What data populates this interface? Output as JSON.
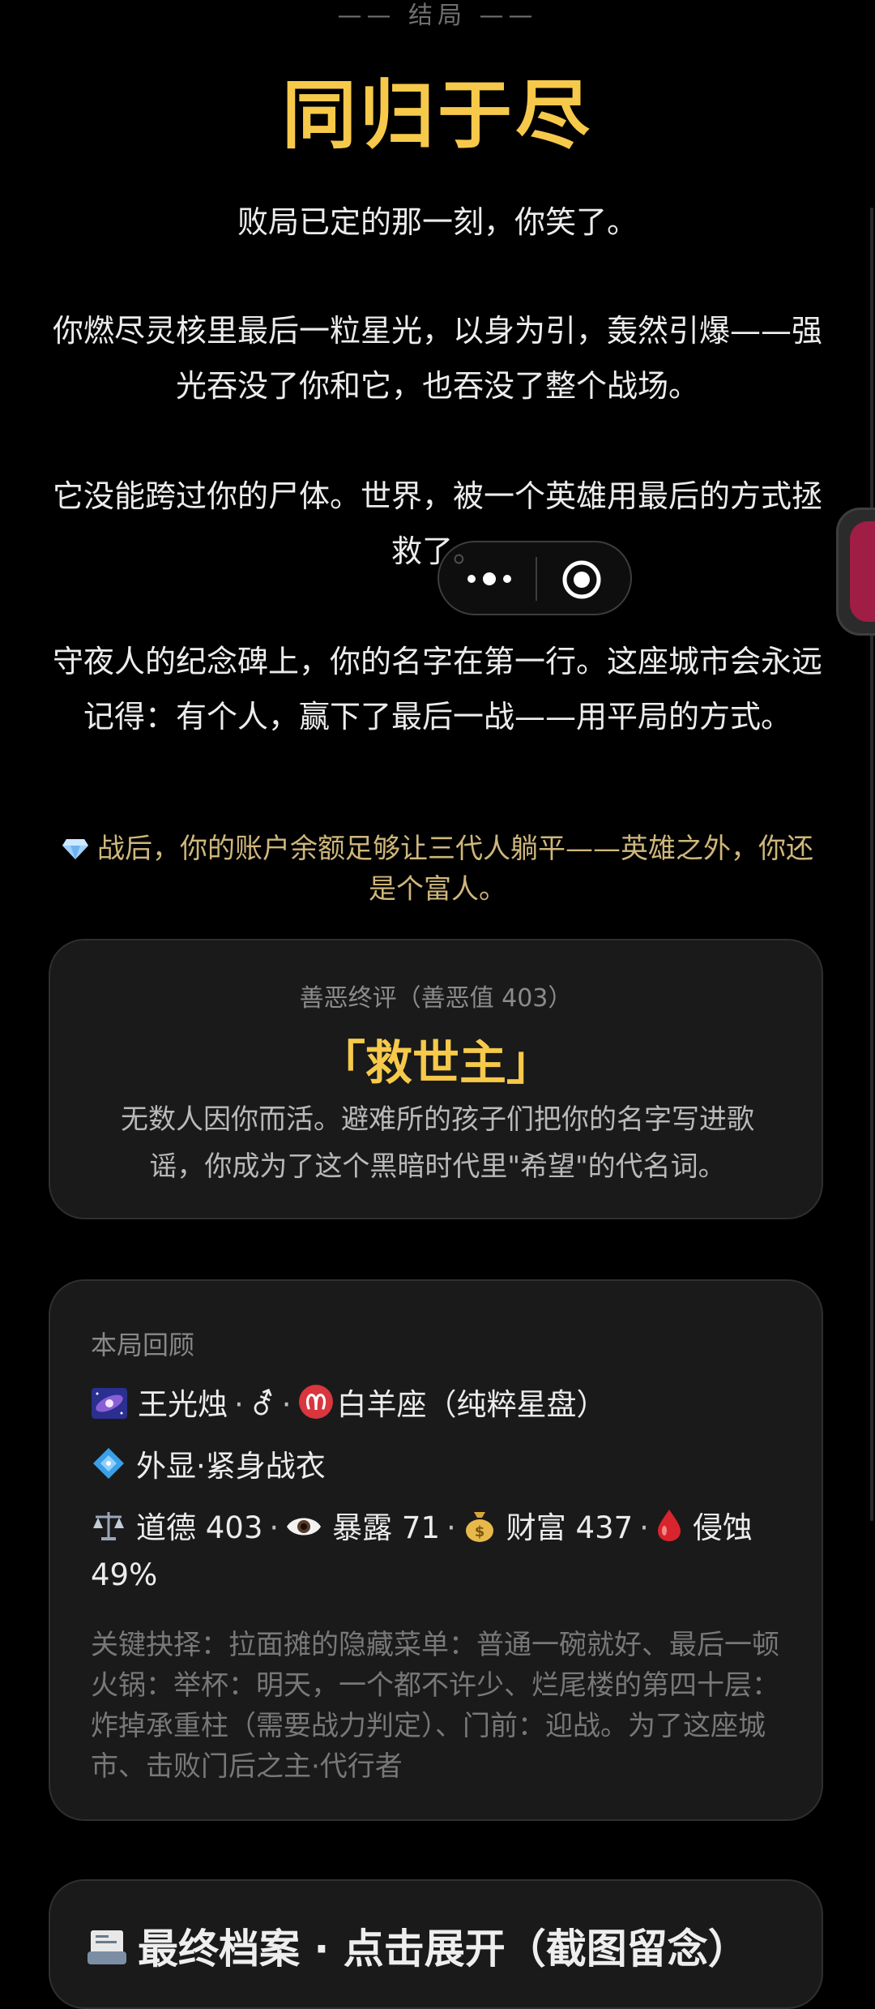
{
  "ending": {
    "label": "—— 结局 ——",
    "title": "同归于尽"
  },
  "story": {
    "p1": "败局已定的那一刻，你笑了。",
    "p2": "你燃尽灵核里最后一粒星光，以身为引，轰然引爆——强光吞没了你和它，也吞没了整个战场。",
    "p3": "它没能跨过你的尸体。世界，被一个英雄用最后的方式拯救了。",
    "p4": "守夜人的纪念碑上，你的名字在第一行。这座城市会永远记得：有个人，赢下了最后一战——用平局的方式。"
  },
  "wealth_note": "战后，你的账户余额足够让三代人躺平——英雄之外，你还是个富人。",
  "judgement": {
    "header": "善恶终评（善恶值 403）",
    "title": "「救世主」",
    "description": "无数人因你而活。避难所的孩子们把你的名字写进歌谣，你成为了这个黑暗时代里\"希望\"的代名词。"
  },
  "recap": {
    "header": "本局回顾",
    "name": "王光烛",
    "gender_symbol": "⚦",
    "zodiac": "白羊座（纯粹星盘）",
    "appearance": "外显·紧身战衣",
    "stats": {
      "morality_label": "道德",
      "morality": "403",
      "exposure_label": "暴露",
      "exposure": "71",
      "wealth_label": "财富",
      "wealth": "437",
      "corrosion_label": "侵蚀",
      "corrosion": "49%"
    },
    "choices": "关键抉择：拉面摊的隐藏菜单：普通一碗就好、最后一顿火锅：举杯：明天，一个都不许少、烂尾楼的第四十层：炸掉承重柱（需要战力判定）、门前：迎战。为了这座城市、击败门后之主·代行者"
  },
  "archive": {
    "title": "最终档案 · 点击展开（截图留念）"
  },
  "icons": {
    "gem": "gem-icon",
    "galaxy": "galaxy-icon",
    "aries": "aries-icon",
    "diamond": "diamond-shape-icon",
    "scales": "scales-icon",
    "eye": "eye-icon",
    "money_bag": "money-bag-icon",
    "blood_drop": "blood-drop-icon",
    "archive": "archive-icon",
    "more": "more-dots-icon",
    "close": "target-close-icon"
  },
  "colors": {
    "accent_gold": "#f6c94a",
    "wealth_text": "#cfb77b",
    "card_bg": "#1a1a1b",
    "background": "#000000"
  }
}
